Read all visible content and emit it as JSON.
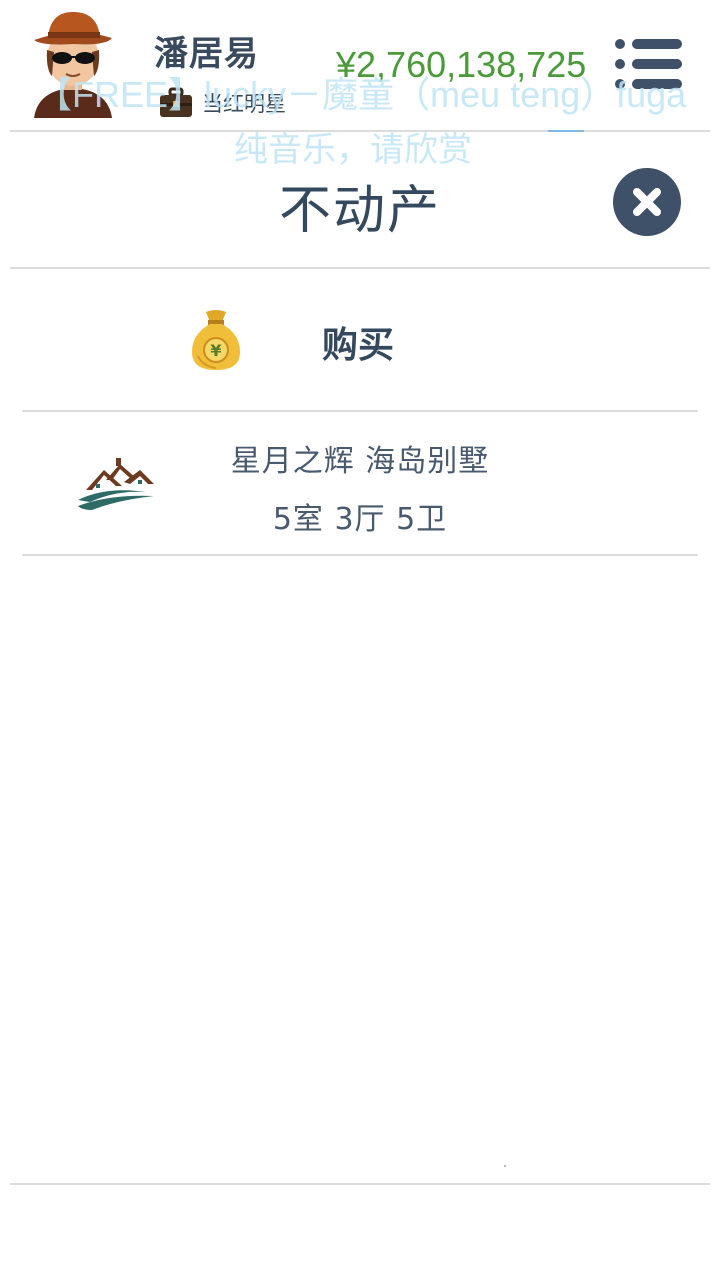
{
  "header": {
    "username": "潘居易",
    "job_title": "当红明星",
    "money": "¥2,760,138,725"
  },
  "music_overlay": {
    "line1": "【FREE】lucky－魔童（meu teng）fuga",
    "line2": "纯音乐，请欣赏"
  },
  "dialog": {
    "title": "不动产",
    "buy_label": "购买",
    "properties": [
      {
        "name": "星月之辉 海岛别墅",
        "rooms": "5室 3厅 5卫"
      }
    ]
  },
  "colors": {
    "money": "#4a9a3a",
    "text": "#34495e",
    "close_button": "#3f5168",
    "overlay": "#bfe4f5"
  },
  "icons": {
    "avatar": "avatar-icon",
    "briefcase": "briefcase-icon",
    "menu": "list-menu-icon",
    "close": "close-icon",
    "buy": "money-bag-icon",
    "property": "house-icon"
  }
}
